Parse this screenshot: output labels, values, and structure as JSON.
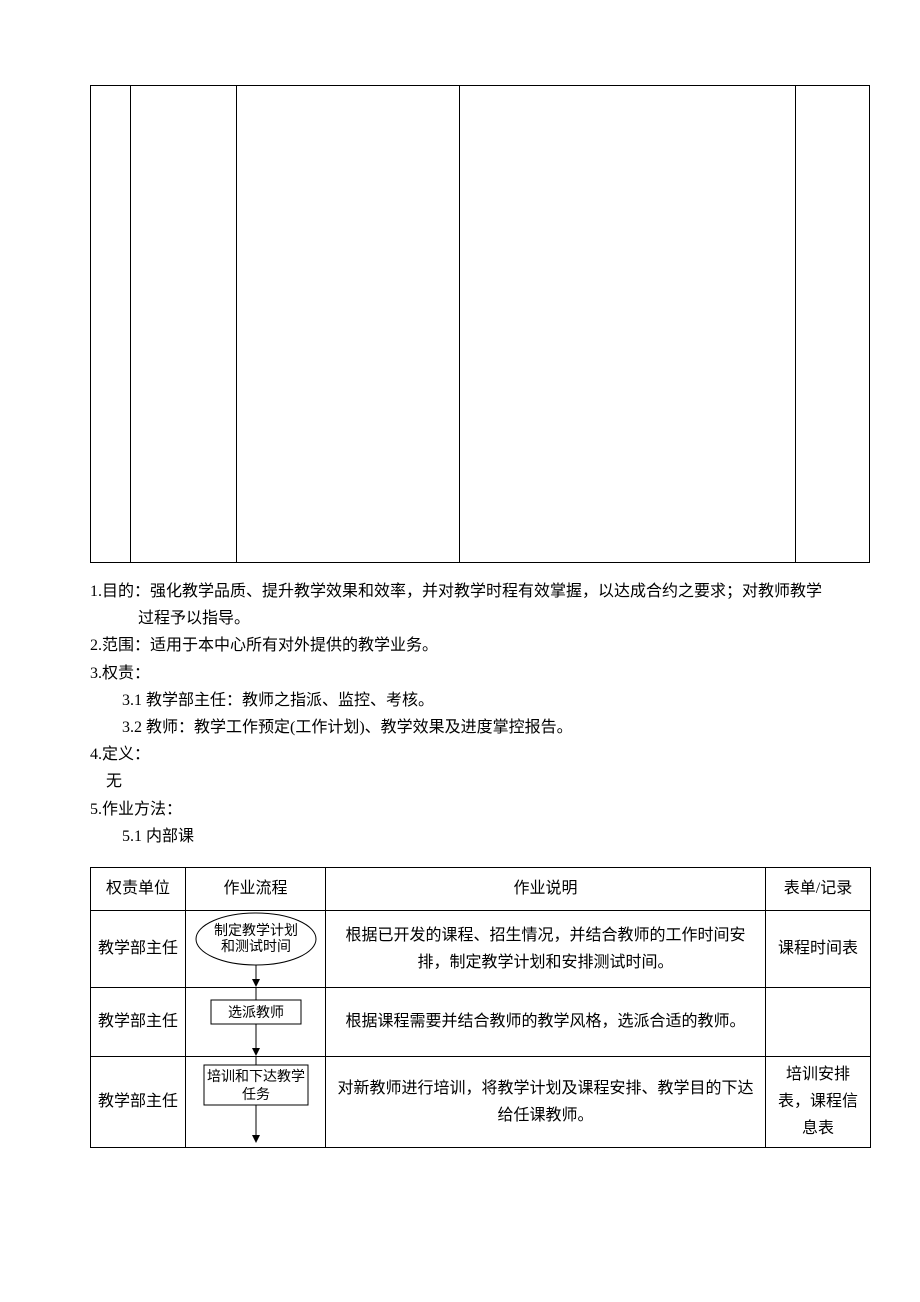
{
  "text": {
    "l1a": "1.目的：强化教学品质、提升教学效果和效率，并对教学时程有效掌握，以达成合约之要求；对教师教学",
    "l1b": "过程予以指导。",
    "l2": "2.范围：适用于本中心所有对外提供的教学业务。",
    "l3": "3.权责：",
    "l31": "3.1 教学部主任：教师之指派、监控、考核。",
    "l32": "3.2 教师：教学工作预定(工作计划)、教学效果及进度掌控报告。",
    "l4": "4.定义：",
    "l4n": "无",
    "l5": "5.作业方法：",
    "l51": "5.1 内部课"
  },
  "table": {
    "headers": {
      "a": "权责单位",
      "b": "作业流程",
      "c": "作业说明",
      "d": "表单/记录"
    },
    "rows": {
      "r1": {
        "unit": "教学部主任",
        "flow": "制定教学计划和测试时间",
        "desc": "根据已开发的课程、招生情况，并结合教师的工作时间安排，制定教学计划和安排测试时间。",
        "record": "课程时间表"
      },
      "r2": {
        "unit": "教学部主任",
        "flow": "选派教师",
        "desc": "根据课程需要并结合教师的教学风格，选派合适的教师。",
        "record": ""
      },
      "r3": {
        "unit": "教学部主任",
        "flow": "培训和下达教学任务",
        "desc": "对新教师进行培训，将教学计划及课程安排、教学目的下达给任课教师。",
        "record": "培训安排表，课程信息表"
      }
    }
  }
}
